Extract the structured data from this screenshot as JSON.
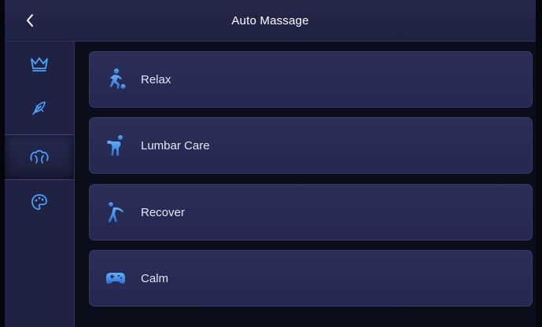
{
  "header": {
    "title": "Auto Massage"
  },
  "sidebar": {
    "items": [
      {
        "name": "crown"
      },
      {
        "name": "feather"
      },
      {
        "name": "muscle"
      },
      {
        "name": "palette"
      }
    ]
  },
  "programs": [
    {
      "label": "Relax"
    },
    {
      "label": "Lumbar Care"
    },
    {
      "label": "Recover"
    },
    {
      "label": "Calm"
    }
  ],
  "colors": {
    "accent": "#3f8fe0",
    "card": "#2a2d55",
    "background": "#0b0d1a"
  }
}
